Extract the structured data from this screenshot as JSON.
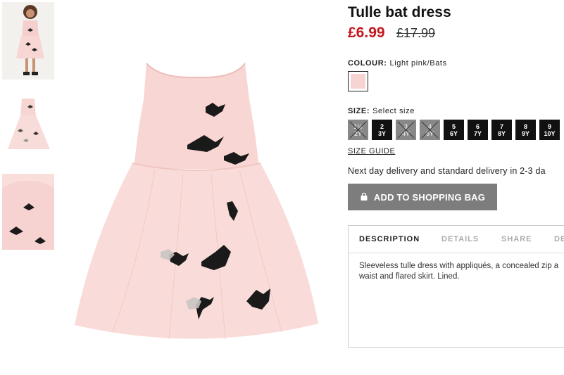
{
  "product": {
    "title": "Tulle bat dress",
    "price_now": "£6.99",
    "price_old": "£17.99"
  },
  "colour": {
    "label": "COLOUR:",
    "value": "Light pink/Bats",
    "swatch_color": "#f7d4d2"
  },
  "size": {
    "label": "SIZE:",
    "value": "Select size",
    "options": [
      {
        "line1": "1½",
        "line2": "2Y",
        "available": false
      },
      {
        "line1": "2",
        "line2": "3Y",
        "available": true
      },
      {
        "line1": "3",
        "line2": "4Y",
        "available": false
      },
      {
        "line1": "4",
        "line2": "5Y",
        "available": false
      },
      {
        "line1": "5",
        "line2": "6Y",
        "available": true
      },
      {
        "line1": "6",
        "line2": "7Y",
        "available": true
      },
      {
        "line1": "7",
        "line2": "8Y",
        "available": true
      },
      {
        "line1": "8",
        "line2": "9Y",
        "available": true
      },
      {
        "line1": "9",
        "line2": "10Y",
        "available": true
      }
    ],
    "guide_label": "SIZE GUIDE"
  },
  "delivery_text": "Next day delivery and standard delivery in 2-3 da",
  "add_button": {
    "label": "ADD TO SHOPPING BAG",
    "icon": "bag-icon"
  },
  "tabs": [
    {
      "label": "DESCRIPTION",
      "active": true
    },
    {
      "label": "DETAILS",
      "active": false
    },
    {
      "label": "SHARE",
      "active": false
    },
    {
      "label": "DE",
      "active": false
    }
  ],
  "description": "Sleeveless tulle dress with appliqués, a concealed zip a waist and flared skirt. Lined.",
  "colors": {
    "price_red": "#c4161c",
    "button_grey": "#7d7d7d",
    "dress_pink": "#f7d4d2"
  }
}
